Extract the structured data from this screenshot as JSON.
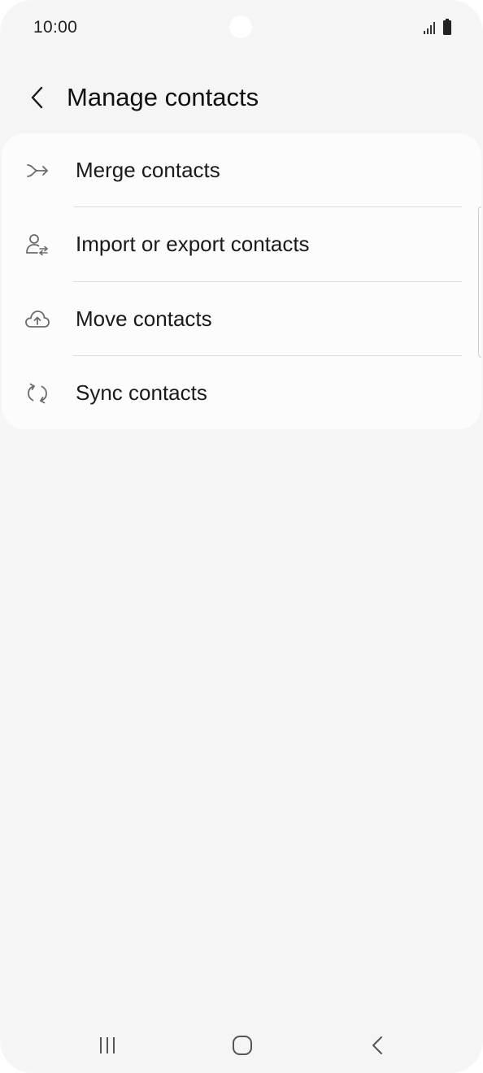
{
  "status_bar": {
    "time": "10:00",
    "icons": [
      "signal-icon",
      "battery-icon"
    ]
  },
  "header": {
    "back_icon": "chevron-left-icon",
    "title": "Manage contacts"
  },
  "menu": {
    "items": [
      {
        "label": "Merge contacts",
        "icon": "merge-icon"
      },
      {
        "label": "Import or export contacts",
        "icon": "person-transfer-icon"
      },
      {
        "label": "Move contacts",
        "icon": "cloud-upload-icon"
      },
      {
        "label": "Sync contacts",
        "icon": "sync-icon"
      }
    ]
  },
  "nav_bar": {
    "buttons": [
      "recent-apps-icon",
      "home-icon",
      "back-icon"
    ]
  },
  "colors": {
    "background": "#f5f5f5",
    "card": "#fcfcfc",
    "text": "#1a1a1a",
    "icon": "#6b6b6b"
  }
}
